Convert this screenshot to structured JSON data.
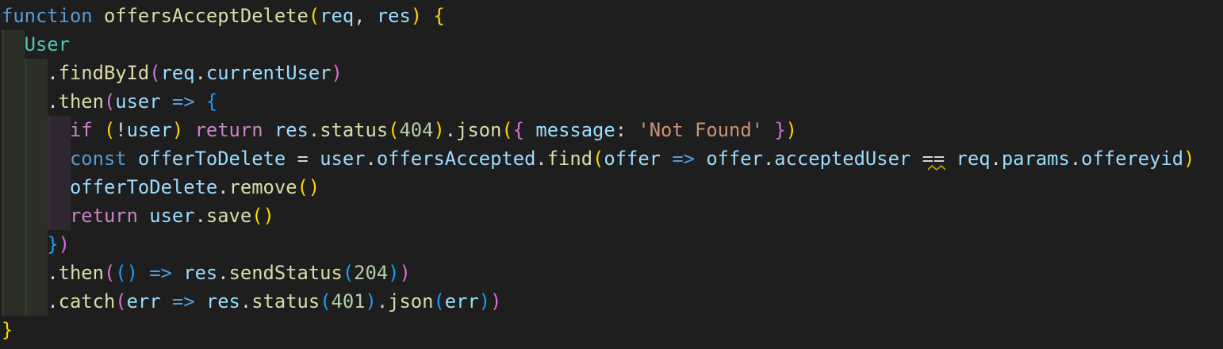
{
  "code": {
    "line1": {
      "kw": "function",
      "name": "offersAcceptDelete",
      "open": "(",
      "p1": "req",
      "comma": ", ",
      "p2": "res",
      "close": ")",
      "brace": "{"
    },
    "line2": {
      "cls": "User"
    },
    "line3": {
      "dot": ".",
      "method": "findById",
      "open": "(",
      "obj": "req",
      "dot2": ".",
      "prop": "currentUser",
      "close": ")"
    },
    "line4": {
      "dot": ".",
      "method": "then",
      "open": "(",
      "param": "user",
      "arrow": "=>",
      "brace": "{"
    },
    "line5": {
      "kw": "if",
      "open": "(",
      "not": "!",
      "var": "user",
      "close": ")",
      "ret": "return",
      "obj": "res",
      "dot": ".",
      "method": "status",
      "open2": "(",
      "num": "404",
      "close2": ")",
      "dot2": ".",
      "method2": "json",
      "open3": "(",
      "brace1": "{",
      "key": "message",
      "colon": ":",
      "str": "'Not Found'",
      "brace2": "}",
      "close3": ")"
    },
    "line6": {
      "kw": "const",
      "name": "offerToDelete",
      "eq": "=",
      "obj": "user",
      "dot": ".",
      "prop": "offersAccepted",
      "dot2": ".",
      "method": "find",
      "open": "(",
      "param": "offer",
      "arrow": "=>",
      "obj2": "offer",
      "dot3": ".",
      "prop2": "acceptedUser",
      "op": "==",
      "obj3": "req",
      "dot4": ".",
      "prop3": "params",
      "dot5": ".",
      "prop4": "offereyid",
      "close": ")"
    },
    "line7": {
      "name": "offerToDelete",
      "dot": ".",
      "method": "remove",
      "parens": "()"
    },
    "line8": {
      "kw": "return",
      "obj": "user",
      "dot": ".",
      "method": "save",
      "parens": "()"
    },
    "line9": {
      "brace": "}",
      "close": ")"
    },
    "line10": {
      "dot": ".",
      "method": "then",
      "open": "(",
      "parens": "()",
      "arrow": "=>",
      "obj": "res",
      "dot2": ".",
      "method2": "sendStatus",
      "open2": "(",
      "num": "204",
      "close2": ")",
      "close": ")"
    },
    "line11": {
      "dot": ".",
      "method": "catch",
      "open": "(",
      "param": "err",
      "arrow": "=>",
      "obj": "res",
      "dot2": ".",
      "method2": "status",
      "open2": "(",
      "num": "401",
      "close2": ")",
      "dot3": ".",
      "method3": "json",
      "open3": "(",
      "arg": "err",
      "close3": ")",
      "close": ")"
    },
    "line12": {
      "brace": "}"
    }
  },
  "colors": {
    "background": "#1e1e1e",
    "keyword": "#569cd6",
    "control": "#c586c0",
    "function": "#dcdcaa",
    "variable": "#9cdcfe",
    "class": "#4ec9b0",
    "number": "#b5cea8",
    "string": "#ce9178",
    "warning_squiggle": "#cca700"
  }
}
